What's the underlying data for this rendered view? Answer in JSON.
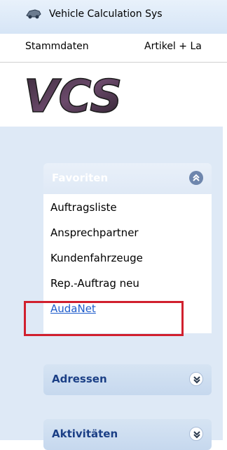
{
  "window": {
    "title": "Vehicle Calculation Sys"
  },
  "menu": {
    "items": [
      "Stammdaten",
      "Artikel + La"
    ]
  },
  "logo": {
    "text": "VCS"
  },
  "sidebar": {
    "favorites": {
      "header": "Favoriten",
      "items": [
        "Auftragsliste",
        "Ansprechpartner",
        "Kundenfahrzeuge",
        "Rep.-Auftrag neu",
        "AudaNet"
      ]
    },
    "groups": [
      {
        "header": "Adressen"
      },
      {
        "header": "Aktivitäten"
      }
    ]
  },
  "colors": {
    "highlight": "#d1202e",
    "link": "#1f5dcc",
    "pane_bg": "#dee9f6",
    "group_header_text": "#1b3f86"
  },
  "icons": {
    "app": "car-icon",
    "favorites_toggle": "chevron-up-double-icon",
    "collapsed_toggle": "chevron-down-double-icon"
  }
}
